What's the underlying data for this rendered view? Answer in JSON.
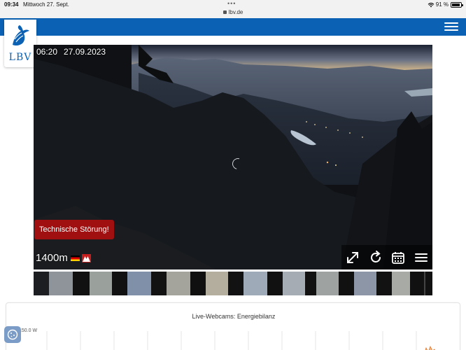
{
  "status_bar": {
    "time": "09:34",
    "date": "Mittwoch 27. Sept.",
    "url": "lbv.de",
    "battery": "91 %"
  },
  "header": {
    "logo_text": "LBV",
    "menu_icon": "hamburger-icon"
  },
  "webcam": {
    "time": "06:20",
    "date": "27.09.2023",
    "alert": "Technische Störung!",
    "altitude": "1400m",
    "controls": [
      "fullscreen-icon",
      "reload-icon",
      "calendar-icon",
      "menu-icon"
    ]
  },
  "chart": {
    "title": "Live-Webcams: Energiebilanz",
    "ylabel": "150.0 W"
  },
  "colors": {
    "brand_blue": "#0b61b3",
    "alert_red": "#a01010"
  }
}
